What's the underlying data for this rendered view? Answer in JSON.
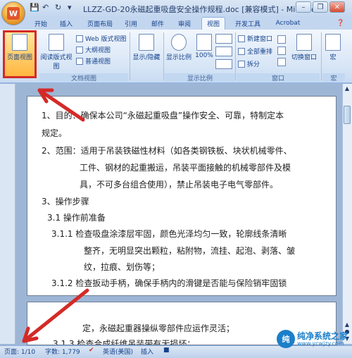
{
  "app": {
    "title": "LLZZ-GD-20永磁起重吸盘安全操作规程.doc [兼容模式] - Microsoft",
    "office_logo": "W",
    "quick_access": [
      "save-icon",
      "undo-icon",
      "redo-icon",
      "customize-icon"
    ]
  },
  "tabs": [
    {
      "label": "开始"
    },
    {
      "label": "插入"
    },
    {
      "label": "页面布局"
    },
    {
      "label": "引用"
    },
    {
      "label": "邮件"
    },
    {
      "label": "审阅"
    },
    {
      "label": "视图"
    },
    {
      "label": "开发工具"
    },
    {
      "label": "Acrobat"
    }
  ],
  "active_tab": "视图",
  "ribbon": {
    "doc_views": {
      "group_label": "文档视图",
      "print_layout": "页面视图",
      "full_screen_reading": "阅读版式视图",
      "web_layout": "Web 版式视图",
      "outline": "大纲视图",
      "draft": "普通视图"
    },
    "show_hide": {
      "label": "显示/隐藏"
    },
    "zoom": {
      "group_label": "显示比例",
      "zoom": "显示比例",
      "percent": "100%"
    },
    "window": {
      "group_label": "窗口",
      "new_window": "新建窗口",
      "arrange_all": "全部重排",
      "split": "拆分",
      "switch_windows": "切换窗口"
    },
    "macros": {
      "group_label": "宏",
      "macros": "宏"
    }
  },
  "document": {
    "page1_lines": [
      "1、目的：确保本公司“永磁起重吸盘”操作安全、可靠，特制定本",
      "规定。",
      "2、范围：适用于吊装铁磁性材料（如各类钢铁板、块状机械零件、",
      "工件、钢材的起重搬运，吊装平面接触的机械零部件及模",
      "具，不可多台组合使用），禁止吊装电子电气零部件。",
      "3、操作步骤",
      "3.1 操作前准备",
      "3.1.1 检查吸盘涂漆层牢固，颜色光泽均匀一致，轮廓线条清晰",
      "整齐，无明显突出颗粒，粘附物，流挂、起泡、剥落、皱",
      "纹，拉痕、划伤等；",
      "3.1.2 检查扳动手柄，确保手柄内的滑键是否能与保险销牢固锁"
    ],
    "page2_lines": [
      "定，永磁起重器操纵零部件应运作灵活；",
      "3.1.3 检查合成纤维吊装带有无损坏；"
    ]
  },
  "status": {
    "page": "页面: 1/10",
    "words": "字数: 1,779",
    "language": "英语(美国)",
    "insert": "插入"
  },
  "watermark": {
    "logo": "纯",
    "name": "纯净系统之家",
    "url": "www.ycwjzy.com"
  },
  "colors": {
    "highlight": "#d42a27",
    "ribbon_bg": "#dbe6f4",
    "text_blue": "#15428b"
  }
}
